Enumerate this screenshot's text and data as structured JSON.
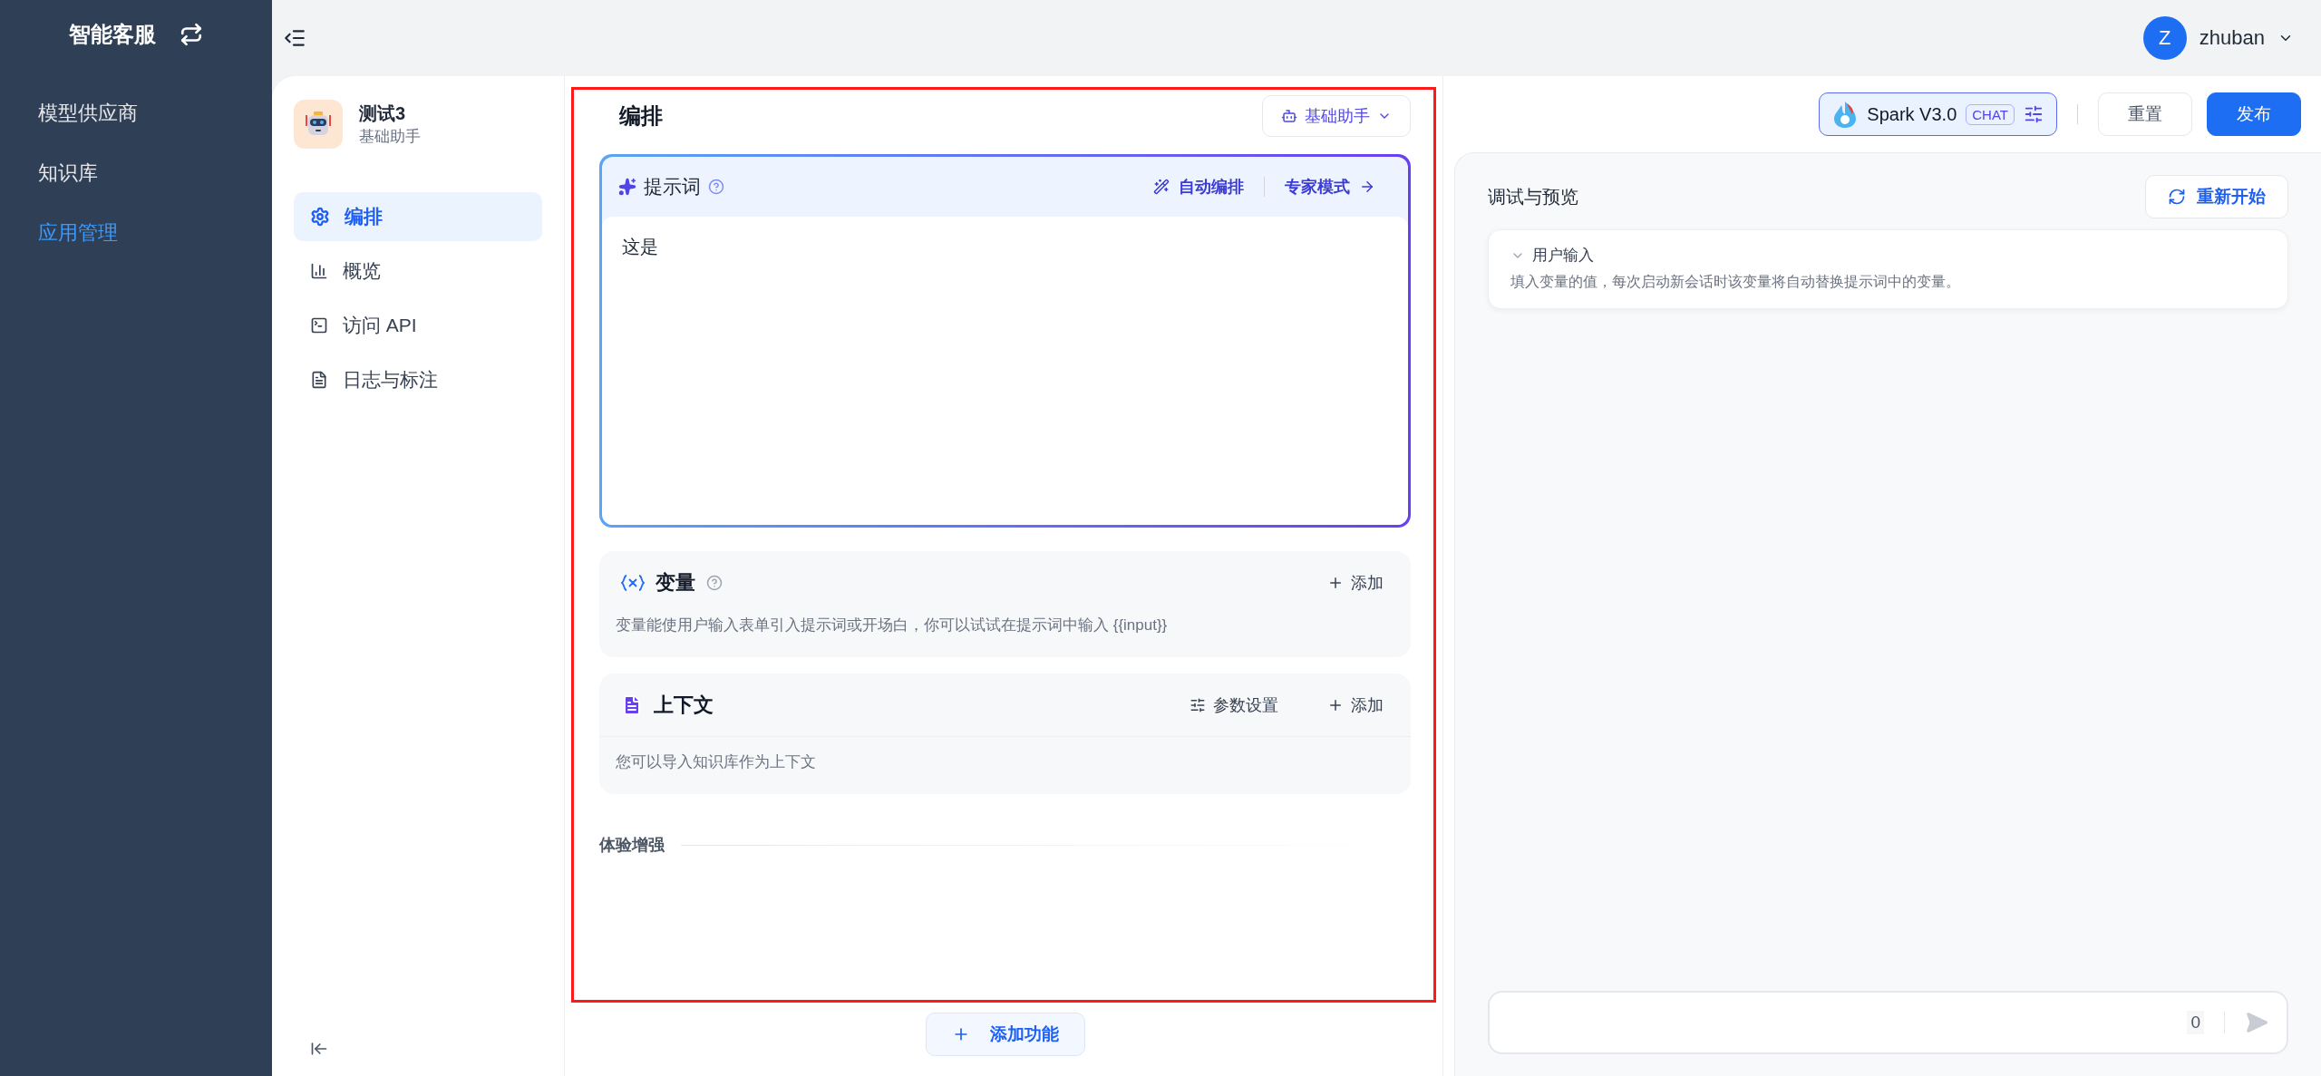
{
  "sidebar": {
    "title": "智能客服",
    "items": [
      {
        "label": "模型供应商",
        "selected": false
      },
      {
        "label": "知识库",
        "selected": false
      },
      {
        "label": "应用管理",
        "selected": true
      }
    ]
  },
  "user": {
    "initial": "Z",
    "name": "zhuban"
  },
  "app": {
    "name": "测试3",
    "type": "基础助手",
    "nav": [
      {
        "label": "编排",
        "selected": true,
        "kind": "gear"
      },
      {
        "label": "概览",
        "selected": false,
        "kind": "chart"
      },
      {
        "label": "访问 API",
        "selected": false,
        "kind": "terminal"
      },
      {
        "label": "日志与标注",
        "selected": false,
        "kind": "file"
      }
    ]
  },
  "editor": {
    "title": "编排",
    "highlighted": true,
    "mode_dropdown": "基础助手",
    "prompt": {
      "label": "提示词",
      "auto_arrange": "自动编排",
      "expert_mode": "专家模式",
      "value": "这是"
    },
    "variables": {
      "title": "变量",
      "add": "添加",
      "hint": "变量能使用户输入表单引入提示词或开场白，你可以试试在提示词中输入 {{input}}"
    },
    "context": {
      "title": "上下文",
      "settings": "参数设置",
      "add": "添加",
      "hint": "您可以导入知识库作为上下文"
    },
    "section_label": "体验增强",
    "add_feature": "添加功能"
  },
  "toolbar": {
    "model": "Spark V3.0",
    "model_tag": "CHAT",
    "reset": "重置",
    "publish": "发布"
  },
  "preview": {
    "title": "调试与预览",
    "restart": "重新开始",
    "user_input": {
      "title": "用户输入",
      "expanded": true,
      "hint": "填入变量的值，每次启动新会话时该变量将自动替换提示词中的变量。"
    },
    "chat_input": {
      "count": "0"
    }
  }
}
